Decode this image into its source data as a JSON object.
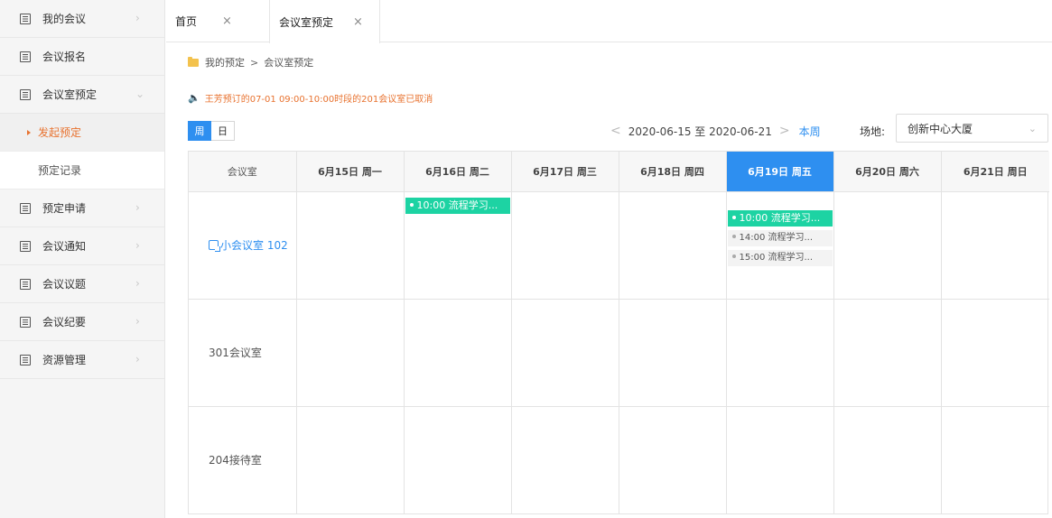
{
  "sidebar": {
    "items": [
      {
        "label": "我的会议",
        "type": "item",
        "chevron": "right"
      },
      {
        "label": "会议报名",
        "type": "item",
        "chevron": ""
      },
      {
        "label": "会议室预定",
        "type": "item",
        "chevron": "down"
      },
      {
        "label": "发起预定",
        "type": "sub",
        "active": true
      },
      {
        "label": "预定记录",
        "type": "sub",
        "active": false
      },
      {
        "label": "预定申请",
        "type": "item",
        "chevron": "right"
      },
      {
        "label": "会议通知",
        "type": "item",
        "chevron": "right"
      },
      {
        "label": "会议议题",
        "type": "item",
        "chevron": "right"
      },
      {
        "label": "会议纪要",
        "type": "item",
        "chevron": "right"
      },
      {
        "label": "资源管理",
        "type": "item",
        "chevron": "right"
      }
    ]
  },
  "tabs": [
    {
      "label": "首页",
      "close": "×"
    },
    {
      "label": "会议室预定",
      "close": "×"
    }
  ],
  "breadcrumb": {
    "parent": "我的预定",
    "separator": ">",
    "current": "会议室预定"
  },
  "notice": "王芳预订的07-01 09:00-10:00时段的201会议室已取消",
  "view_toggle": {
    "week": "周",
    "day": "日",
    "selected": "week"
  },
  "date_nav": {
    "prev": "<",
    "range": "2020-06-15 至 2020-06-21",
    "next": ">",
    "this_week": "本周"
  },
  "venue": {
    "label": "场地:",
    "selected": "创新中心大厦",
    "dropdown_icon": "chevron-down-icon"
  },
  "grid": {
    "headers": [
      "会议室",
      "6月15日 周一",
      "6月16日 周二",
      "6月17日 周三",
      "6月18日 周四",
      "6月19日 周五",
      "6月20日 周六",
      "6月21日 周日"
    ],
    "today_index": 5,
    "rooms": [
      {
        "name": "小会议室 102",
        "linked": true
      },
      {
        "name": "301会议室",
        "linked": false
      },
      {
        "name": "204接待室",
        "linked": false
      }
    ],
    "events": {
      "room0_tue": [
        "10:00 流程学习..."
      ],
      "room0_fri": [
        "10:00 流程学习...",
        "14:00 流程学习...",
        "15:00 流程学习..."
      ]
    }
  },
  "colors": {
    "accent_blue": "#2e8ff0",
    "accent_orange": "#e8722f",
    "event_green": "#1dd3a3",
    "event_grey": "#f3f3f3"
  }
}
